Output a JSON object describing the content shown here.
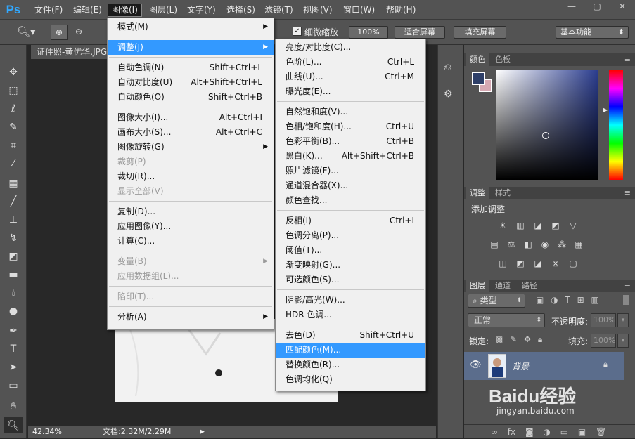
{
  "app": {
    "logo": "Ps"
  },
  "menubar": [
    "文件(F)",
    "编辑(E)",
    "图像(I)",
    "图层(L)",
    "文字(Y)",
    "选择(S)",
    "滤镜(T)",
    "视图(V)",
    "窗口(W)",
    "帮助(H)"
  ],
  "options": {
    "fine_zoom": "细微缩放",
    "zoom_pct": "100%",
    "fit_screen": "适合屏幕",
    "fill_screen": "填充屏幕",
    "workspace": "基本功能"
  },
  "doc": {
    "tab": "证件照-黄优华.JPG"
  },
  "status": {
    "zoom": "42.34%",
    "doc": "文档:2.32M/2.29M"
  },
  "image_menu": [
    {
      "label": "模式(M)",
      "sub": true
    },
    {
      "sep": true
    },
    {
      "label": "调整(J)",
      "sub": true,
      "hl": true
    },
    {
      "sep": true
    },
    {
      "label": "自动色调(N)",
      "sc": "Shift+Ctrl+L"
    },
    {
      "label": "自动对比度(U)",
      "sc": "Alt+Shift+Ctrl+L"
    },
    {
      "label": "自动颜色(O)",
      "sc": "Shift+Ctrl+B"
    },
    {
      "sep": true
    },
    {
      "label": "图像大小(I)...",
      "sc": "Alt+Ctrl+I"
    },
    {
      "label": "画布大小(S)...",
      "sc": "Alt+Ctrl+C"
    },
    {
      "label": "图像旋转(G)",
      "sub": true
    },
    {
      "label": "裁剪(P)",
      "dis": true
    },
    {
      "label": "裁切(R)..."
    },
    {
      "label": "显示全部(V)",
      "dis": true
    },
    {
      "sep": true
    },
    {
      "label": "复制(D)..."
    },
    {
      "label": "应用图像(Y)..."
    },
    {
      "label": "计算(C)..."
    },
    {
      "sep": true
    },
    {
      "label": "变量(B)",
      "sub": true,
      "dis": true
    },
    {
      "label": "应用数据组(L)...",
      "dis": true
    },
    {
      "sep": true
    },
    {
      "label": "陷印(T)...",
      "dis": true
    },
    {
      "sep": true
    },
    {
      "label": "分析(A)",
      "sub": true
    }
  ],
  "adjust_menu": [
    {
      "label": "亮度/对比度(C)..."
    },
    {
      "label": "色阶(L)...",
      "sc": "Ctrl+L"
    },
    {
      "label": "曲线(U)...",
      "sc": "Ctrl+M"
    },
    {
      "label": "曝光度(E)..."
    },
    {
      "sep": true
    },
    {
      "label": "自然饱和度(V)..."
    },
    {
      "label": "色相/饱和度(H)...",
      "sc": "Ctrl+U"
    },
    {
      "label": "色彩平衡(B)...",
      "sc": "Ctrl+B"
    },
    {
      "label": "黑白(K)...",
      "sc": "Alt+Shift+Ctrl+B"
    },
    {
      "label": "照片滤镜(F)..."
    },
    {
      "label": "通道混合器(X)..."
    },
    {
      "label": "颜色查找..."
    },
    {
      "sep": true
    },
    {
      "label": "反相(I)",
      "sc": "Ctrl+I"
    },
    {
      "label": "色调分离(P)..."
    },
    {
      "label": "阈值(T)..."
    },
    {
      "label": "渐变映射(G)..."
    },
    {
      "label": "可选颜色(S)..."
    },
    {
      "sep": true
    },
    {
      "label": "阴影/高光(W)..."
    },
    {
      "label": "HDR 色调..."
    },
    {
      "sep": true
    },
    {
      "label": "去色(D)",
      "sc": "Shift+Ctrl+U"
    },
    {
      "label": "匹配颜色(M)...",
      "hl": true
    },
    {
      "label": "替换颜色(R)..."
    },
    {
      "label": "色调均化(Q)"
    }
  ],
  "color_panel": {
    "tabs": [
      "颜色",
      "色板"
    ],
    "fg": "#2e3f68",
    "bg": "#d6a9b3"
  },
  "adjust_panel": {
    "tabs": [
      "调整",
      "样式"
    ],
    "title": "添加调整"
  },
  "layers_panel": {
    "tabs": [
      "图层",
      "通道",
      "路径"
    ],
    "filter": "类型",
    "blend": "正常",
    "opacity_label": "不透明度:",
    "opacity": "100%",
    "lock_label": "锁定:",
    "fill_label": "填充:",
    "fill": "100%",
    "layer_name": "背景"
  },
  "watermark": {
    "text": "Baidu经验",
    "url": "jingyan.baidu.com"
  }
}
